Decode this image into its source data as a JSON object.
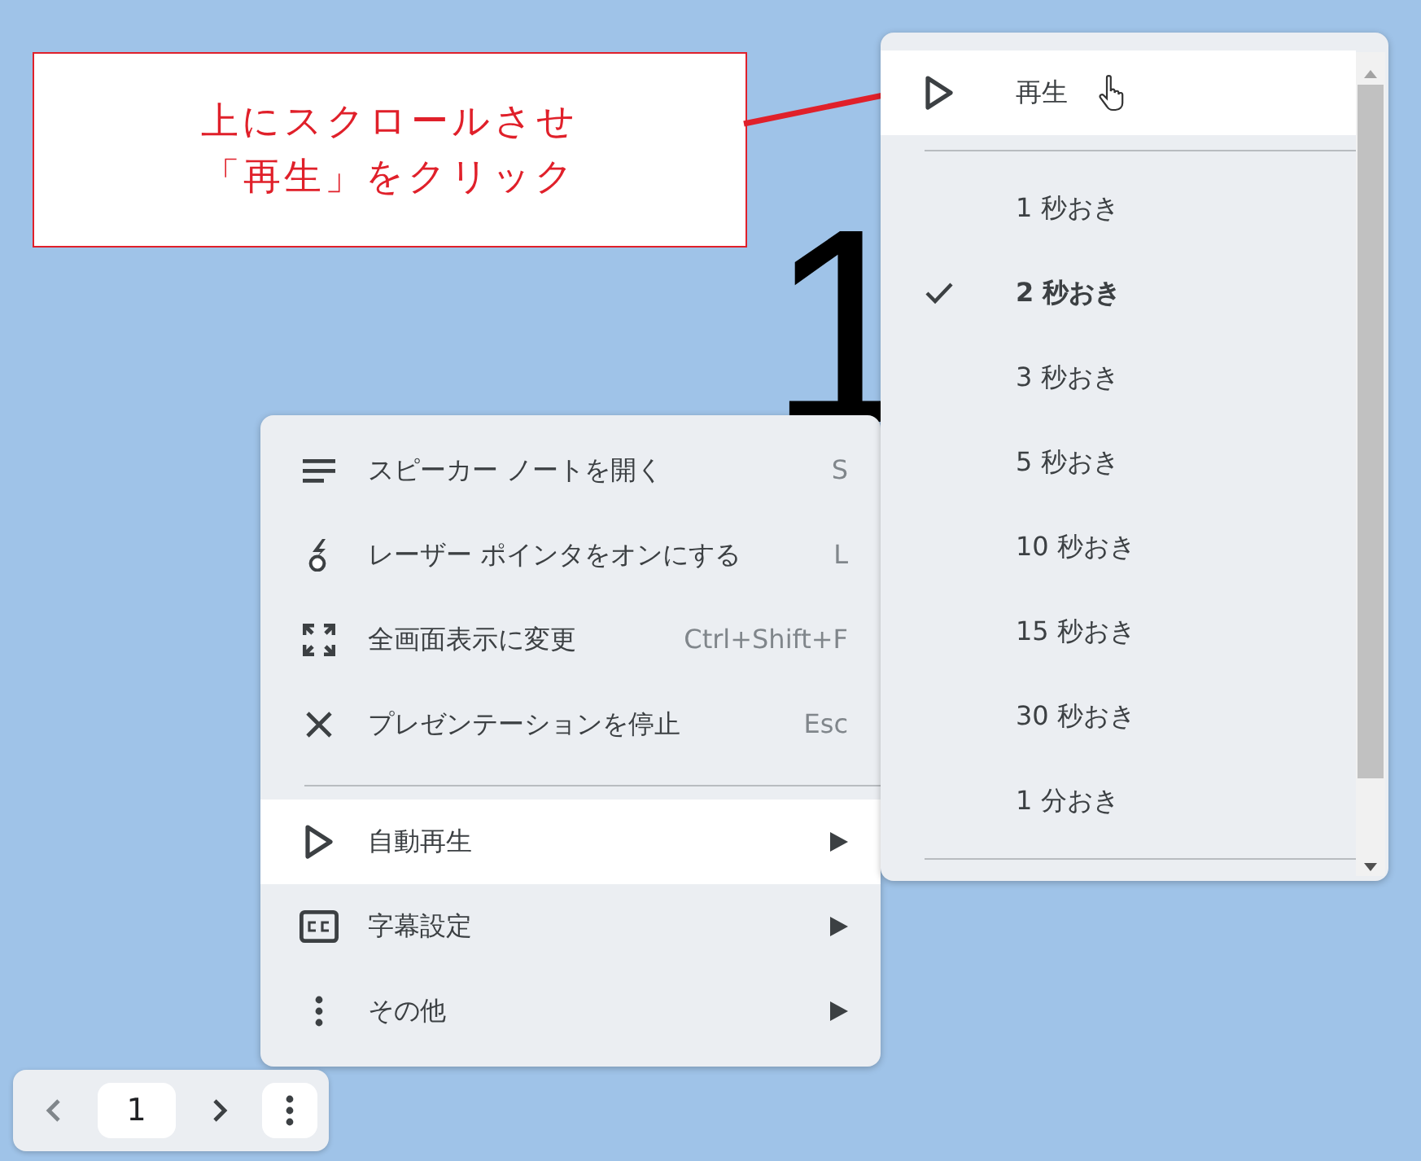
{
  "slide": {
    "text": "1"
  },
  "callout": {
    "lines": [
      "上にスクロールさせ",
      "「再生」をクリック"
    ]
  },
  "menu": {
    "sections": [
      [
        {
          "kind": "command",
          "label": "スピーカー ノートを開く",
          "shortcut": "S",
          "highlighted": false
        },
        {
          "kind": "command",
          "label": "レーザー ポインタをオンにする",
          "shortcut": "L",
          "highlighted": false
        },
        {
          "kind": "command",
          "label": "全画面表示に変更",
          "shortcut": "Ctrl+Shift+F",
          "highlighted": false
        },
        {
          "kind": "command",
          "label": "プレゼンテーションを停止",
          "shortcut": "Esc",
          "highlighted": false
        }
      ],
      [
        {
          "kind": "submenu",
          "label": "自動再生",
          "highlighted": true
        },
        {
          "kind": "submenu",
          "label": "字幕設定",
          "highlighted": false
        },
        {
          "kind": "submenu",
          "label": "その他",
          "highlighted": false
        }
      ]
    ]
  },
  "submenu": {
    "play": {
      "label": "再生",
      "highlighted": true
    },
    "intervals": [
      {
        "label": "1 秒おき",
        "checked": false
      },
      {
        "label": "2 秒おき",
        "checked": true
      },
      {
        "label": "3 秒おき",
        "checked": false
      },
      {
        "label": "5 秒おき",
        "checked": false
      },
      {
        "label": "10 秒おき",
        "checked": false
      },
      {
        "label": "15 秒おき",
        "checked": false
      },
      {
        "label": "30 秒おき",
        "checked": false
      },
      {
        "label": "1 分おき",
        "checked": false
      }
    ]
  },
  "toolbar": {
    "page": "1",
    "prev": {
      "disabled": true
    },
    "next": {
      "disabled": false
    }
  }
}
